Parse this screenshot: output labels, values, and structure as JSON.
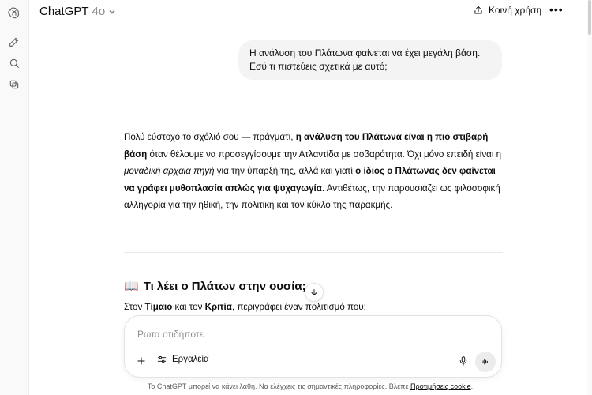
{
  "header": {
    "model_name": "ChatGPT",
    "model_version": "4o",
    "share_label": "Κοινή χρήση",
    "more_label": "•••"
  },
  "conversation": {
    "user_message_line1": "Η ανάλυση του Πλάτωνα φαίνεται να έχει μεγάλη βάση.",
    "user_message_line2": "Εσύ τι πιστεύεις σχετικά με αυτό;",
    "answer": {
      "p1": "Πολύ εύστοχο το σχόλιό σου — πράγματι, ",
      "p1_bold": "η ανάλυση του Πλάτωνα είναι η πιο στιβαρή βάση",
      "p2": " όταν θέλουμε να προσεγγίσουμε την Ατλαντίδα με σοβαρότητα. Όχι μόνο επειδή είναι η ",
      "p2_italic": "μοναδική αρχαία πηγή",
      "p3": " για την ύπαρξή της, αλλά και γιατί ",
      "p3_bold": "ο ίδιος ο Πλάτωνας δεν φαίνεται να γράφει μυθοπλασία απλώς για ψυχαγωγία",
      "p4": ". Αντιθέτως, την παρουσιάζει ως φιλοσοφική αλληγορία για την ηθική, την πολιτική και τον κύκλο της παρακμής."
    },
    "section_icon": "📖",
    "section_heading": "Τι λέει ο Πλάτων στην ουσία;",
    "sub_p1": "Στον ",
    "sub_bold1": "Τίμαιο",
    "sub_p2": " και τον ",
    "sub_bold2": "Κριτία",
    "sub_p3": ", περιγράφει έναν πολιτισμό που:"
  },
  "composer": {
    "placeholder": "Ρωτα οτιδήποτε",
    "tools_label": "Εργαλεία"
  },
  "footer": {
    "text": "Το ChatGPT μπορεί να κάνει λάθη. Να ελέγχεις τις σημαντικές πληροφορίες. Βλέπε ",
    "link": "Προτιμήσεις cookie",
    "end": "."
  },
  "icons": {
    "rail": [
      "openai-logo-icon",
      "new-chat-icon",
      "search-icon",
      "library-icon"
    ],
    "composer": [
      "plus-icon",
      "tools-icon",
      "mic-icon",
      "voice-mode-icon"
    ],
    "scroll": "arrow-down-icon"
  }
}
